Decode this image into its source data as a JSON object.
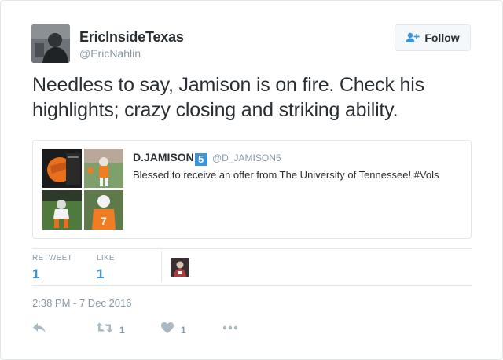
{
  "author": {
    "display_name": "EricInsideTexas",
    "handle": "@EricNahlin",
    "avatar_icon": "user-avatar"
  },
  "follow_button": {
    "label": "Follow",
    "icon": "add-user-icon"
  },
  "tweet": {
    "text": "Needless to say, Jamison is on fire. Check his highlights; crazy closing and striking ability."
  },
  "quoted_tweet": {
    "display_name": "D.JAMISON",
    "badge": "5",
    "handle": "@D_JAMISON5",
    "text": "Blessed to receive an offer from The University of Tennessee! #Vols"
  },
  "stats": {
    "retweets_label": "RETWEET",
    "retweets_value": "1",
    "likes_label": "LIKE",
    "likes_value": "1"
  },
  "timestamp": "2:38 PM - 7 Dec 2016",
  "actions": {
    "reply_icon": "reply-icon",
    "retweet_icon": "retweet-icon",
    "retweet_count": "1",
    "like_icon": "heart-icon",
    "like_count": "1",
    "more_icon": "more-icon"
  },
  "colors": {
    "link_blue": "#3b94d9",
    "muted": "#8899a6",
    "text": "#292f33",
    "border": "#e1e8ed"
  }
}
